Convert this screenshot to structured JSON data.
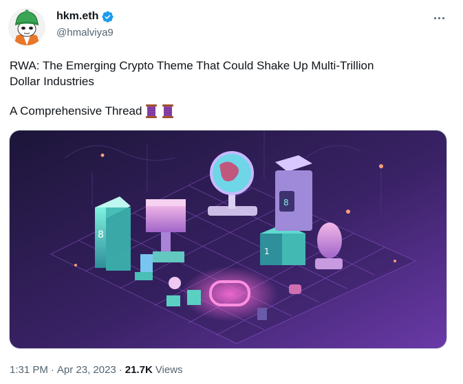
{
  "author": {
    "display_name": "hkm.eth",
    "handle": "@hmalviya9",
    "verified": true
  },
  "tweet": {
    "text_line1": "RWA: The Emerging Crypto Theme That Could Shake Up Multi-Trillion",
    "text_line2": "Dollar Industries",
    "subline": "A Comprehensive Thread",
    "emoji": [
      "thread-spool-emoji",
      "thread-spool-emoji"
    ]
  },
  "meta": {
    "time": "1:31 PM",
    "separator": "·",
    "date": "Apr 23, 2023",
    "views_count": "21.7K",
    "views_label": "Views"
  },
  "icons": {
    "more": "more-options-icon",
    "verified": "verified-badge-icon"
  },
  "colors": {
    "accent": "#1d9bf0",
    "text_primary": "#0f1419",
    "text_secondary": "#536471"
  }
}
